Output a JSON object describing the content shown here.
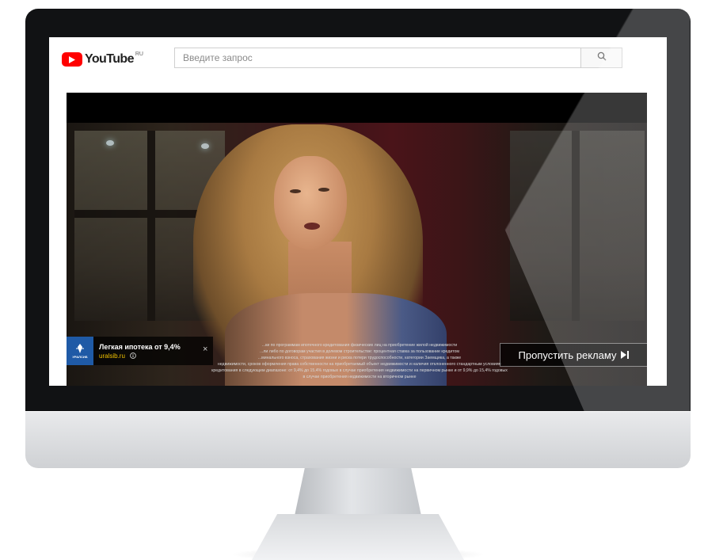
{
  "header": {
    "logo_text": "YouTube",
    "region": "RU",
    "search_placeholder": "Введите запрос",
    "search_icon": "search-icon"
  },
  "ad": {
    "title": "Легкая ипотека от 9,4%",
    "url": "uralsib.ru",
    "advertiser_logo_text": "УРАЛСИБ",
    "close_symbol": "×",
    "info_icon": "info-icon",
    "skip_label": "Пропустить рекламу",
    "skip_icon": "skip-next-icon",
    "legal_lines": [
      "...ки по программам ипотечного кредитования физических лиц на приобретение жилой недвижимости",
      "...ли либо по договорам участия в долевом строительстве: процентная ставка за пользование кредитом",
      "...минального взноса, страхования жизни и риска потери трудоспособности, категории Заемщика, а также",
      "недвижимости, сроков оформления права собственности на приобретаемый объект недвижимости и наличия отклоненного стандартным условиям",
      "кредитования в следующем диапазоне: от 9,4% до 15,4% годовых в случае приобретения недвижимости на первичном рынке и от 9,9% до 15,4% годовых",
      "в случае приобретения недвижимости на вторичном рынке"
    ]
  },
  "colors": {
    "youtube_red": "#ff0000",
    "ad_url_yellow": "#f2c200",
    "advertiser_blue": "#1f5aa6"
  }
}
